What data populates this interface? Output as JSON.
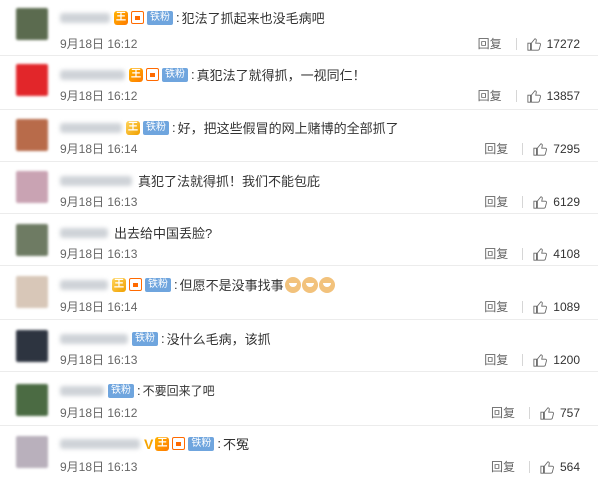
{
  "comments": [
    {
      "text": "犯法了抓起来也没毛病吧",
      "date": "9月18日 16:12",
      "reply": "回复",
      "likes": "17272",
      "avatar_color": "#5b6b4f"
    },
    {
      "text": "真犯法了就得抓，一视同仁！",
      "date": "9月18日 16:12",
      "reply": "回复",
      "likes": "13857",
      "avatar_color": "#e2262a"
    },
    {
      "text": "好，把这些假冒的网上赌博的全部抓了",
      "date": "9月18日 16:14",
      "reply": "回复",
      "likes": "7295",
      "avatar_color": "#b86b4a"
    },
    {
      "text": "真犯了法就得抓！我们不能包庇",
      "date": "9月18日 16:13",
      "reply": "回复",
      "likes": "6129",
      "avatar_color": "#c9a3b3"
    },
    {
      "text": "出去给中国丢脸?",
      "date": "9月18日 16:13",
      "reply": "回复",
      "likes": "4108",
      "avatar_color": "#6e7b63"
    },
    {
      "text": "但愿不是没事找事",
      "date": "9月18日 16:14",
      "reply": "回复",
      "likes": "1089",
      "avatar_color": "#d8c7b8"
    },
    {
      "text": "没什么毛病，该抓",
      "date": "9月18日 16:13",
      "reply": "回复",
      "likes": "1200",
      "avatar_color": "#2d3440"
    },
    {
      "text": "不要回来了吧",
      "date": "9月18日 16:12",
      "reply": "回复",
      "likes": "757",
      "avatar_color": "#4b6b43"
    },
    {
      "text": "不冤",
      "date": "9月18日 16:13",
      "reply": "回复",
      "likes": "564",
      "avatar_color": "#b9b0bc"
    }
  ],
  "fan_label": "铁粉",
  "crown_label": "王",
  "v_label": "V",
  "colon": ":",
  "accent": "#6fa5de"
}
